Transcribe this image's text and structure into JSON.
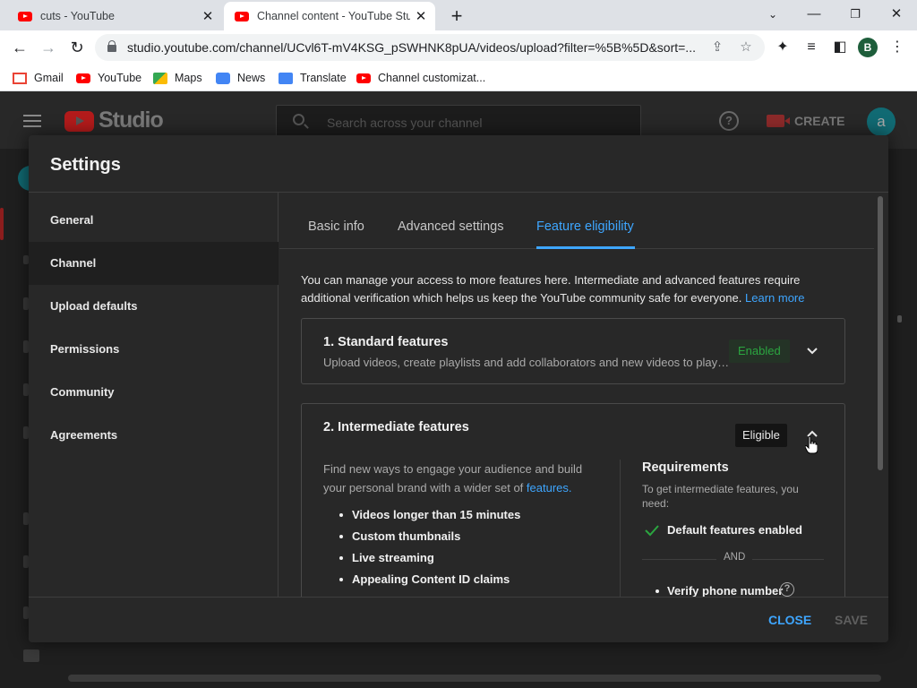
{
  "browser": {
    "tabs": [
      {
        "title": "cuts - YouTube",
        "active": false
      },
      {
        "title": "Channel content - YouTube Studio",
        "active": true
      }
    ],
    "url": "studio.youtube.com/channel/UCvl6T-mV4KSG_pSWHNK8pUA/videos/upload?filter=%5B%5D&sort=...",
    "profile_initial": "B",
    "bookmarks": [
      "Gmail",
      "YouTube",
      "Maps",
      "News",
      "Translate",
      "Channel customizat..."
    ]
  },
  "studio": {
    "logo_text": "Studio",
    "search_placeholder": "Search across your channel",
    "create_label": "CREATE",
    "avatar_initial": "a"
  },
  "dialog": {
    "title": "Settings",
    "sidebar": [
      {
        "label": "General",
        "active": false
      },
      {
        "label": "Channel",
        "active": true
      },
      {
        "label": "Upload defaults",
        "active": false
      },
      {
        "label": "Permissions",
        "active": false
      },
      {
        "label": "Community",
        "active": false
      },
      {
        "label": "Agreements",
        "active": false
      }
    ],
    "tabs": [
      {
        "label": "Basic info",
        "active": false
      },
      {
        "label": "Advanced settings",
        "active": false
      },
      {
        "label": "Feature eligibility",
        "active": true
      }
    ],
    "intro_text": "You can manage your access to more features here. Intermediate and advanced features require additional verification which helps us keep the YouTube community safe for everyone.",
    "intro_link": "Learn more",
    "standard": {
      "title": "1. Standard features",
      "description": "Upload videos, create playlists and add collaborators and new videos to playlists",
      "status": "Enabled"
    },
    "intermediate": {
      "title": "2. Intermediate features",
      "status": "Eligible",
      "description": "Find new ways to engage your audience and build your personal brand with a wider set of",
      "description_link": "features.",
      "features": [
        "Videos longer than 15 minutes",
        "Custom thumbnails",
        "Live streaming",
        "Appealing Content ID claims"
      ],
      "requirements_title": "Requirements",
      "requirements_text": "To get intermediate features, you need:",
      "requirement_done": "Default features enabled",
      "and_label": "AND",
      "requirement_todo": "Verify phone number"
    },
    "footer": {
      "close_label": "CLOSE",
      "save_label": "SAVE"
    }
  },
  "colors": {
    "accent_blue": "#3ea6ff",
    "enabled_green": "#2ba640",
    "dialog_bg": "#282828"
  }
}
